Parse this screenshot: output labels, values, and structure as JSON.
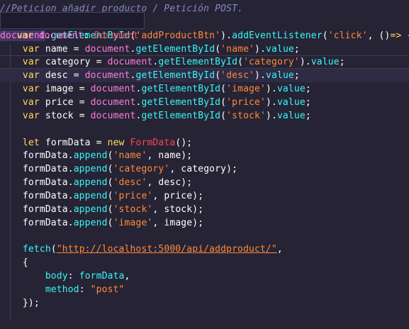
{
  "tooltip": {
    "keyword": "var",
    "identifier": "document",
    "separator": ": ",
    "type": "Document"
  },
  "code_lines": [
    [
      {
        "t": "//Peticion añadir producto / Petición POST.",
        "c": "cmt"
      }
    ],
    [
      {
        "t": "",
        "c": "plain"
      }
    ],
    [
      {
        "t": "document",
        "c": "var",
        "sel": true
      },
      {
        "t": ".",
        "c": "plain"
      },
      {
        "t": "getElementById",
        "c": "fn"
      },
      {
        "t": "(",
        "c": "plain"
      },
      {
        "t": "'addProductBtn'",
        "c": "str"
      },
      {
        "t": ").",
        "c": "plain"
      },
      {
        "t": "addEventListener",
        "c": "fn"
      },
      {
        "t": "(",
        "c": "plain"
      },
      {
        "t": "'click'",
        "c": "str"
      },
      {
        "t": ", ",
        "c": "plain"
      },
      {
        "t": "()",
        "c": "plain"
      },
      {
        "t": "=>",
        "c": "kw"
      },
      {
        "t": " {",
        "c": "plain"
      }
    ],
    [
      {
        "t": "    ",
        "c": "plain"
      },
      {
        "t": "var",
        "c": "kw"
      },
      {
        "t": " name = ",
        "c": "plain"
      },
      {
        "t": "document",
        "c": "var"
      },
      {
        "t": ".",
        "c": "plain"
      },
      {
        "t": "getElementById",
        "c": "fn"
      },
      {
        "t": "(",
        "c": "plain"
      },
      {
        "t": "'name'",
        "c": "str"
      },
      {
        "t": ").",
        "c": "plain"
      },
      {
        "t": "value",
        "c": "fn"
      },
      {
        "t": ";",
        "c": "plain"
      }
    ],
    [
      {
        "t": "    ",
        "c": "plain"
      },
      {
        "t": "var",
        "c": "kw"
      },
      {
        "t": " category = ",
        "c": "plain"
      },
      {
        "t": "document",
        "c": "var"
      },
      {
        "t": ".",
        "c": "plain"
      },
      {
        "t": "getElementById",
        "c": "fn"
      },
      {
        "t": "(",
        "c": "plain"
      },
      {
        "t": "'category'",
        "c": "str"
      },
      {
        "t": ").",
        "c": "plain"
      },
      {
        "t": "value",
        "c": "fn"
      },
      {
        "t": ";",
        "c": "plain"
      }
    ],
    [
      {
        "t": "    ",
        "c": "plain"
      },
      {
        "t": "var",
        "c": "kw"
      },
      {
        "t": " desc = ",
        "c": "plain"
      },
      {
        "t": "document",
        "c": "var"
      },
      {
        "t": ".",
        "c": "plain"
      },
      {
        "t": "getElementById",
        "c": "fn"
      },
      {
        "t": "(",
        "c": "plain"
      },
      {
        "t": "'desc'",
        "c": "str"
      },
      {
        "t": ").",
        "c": "plain"
      },
      {
        "t": "value",
        "c": "fn"
      },
      {
        "t": ";",
        "c": "plain"
      }
    ],
    [
      {
        "t": "    ",
        "c": "plain"
      },
      {
        "t": "var",
        "c": "kw"
      },
      {
        "t": " image = ",
        "c": "plain"
      },
      {
        "t": "document",
        "c": "var"
      },
      {
        "t": ".",
        "c": "plain"
      },
      {
        "t": "getElementById",
        "c": "fn"
      },
      {
        "t": "(",
        "c": "plain"
      },
      {
        "t": "'image'",
        "c": "str"
      },
      {
        "t": ").",
        "c": "plain"
      },
      {
        "t": "value",
        "c": "fn"
      },
      {
        "t": ";",
        "c": "plain"
      }
    ],
    [
      {
        "t": "    ",
        "c": "plain"
      },
      {
        "t": "var",
        "c": "kw"
      },
      {
        "t": " price = ",
        "c": "plain"
      },
      {
        "t": "document",
        "c": "var"
      },
      {
        "t": ".",
        "c": "plain"
      },
      {
        "t": "getElementById",
        "c": "fn"
      },
      {
        "t": "(",
        "c": "plain"
      },
      {
        "t": "'price'",
        "c": "str"
      },
      {
        "t": ").",
        "c": "plain"
      },
      {
        "t": "value",
        "c": "fn"
      },
      {
        "t": ";",
        "c": "plain"
      }
    ],
    [
      {
        "t": "    ",
        "c": "plain"
      },
      {
        "t": "var",
        "c": "kw"
      },
      {
        "t": " stock = ",
        "c": "plain"
      },
      {
        "t": "document",
        "c": "var"
      },
      {
        "t": ".",
        "c": "plain"
      },
      {
        "t": "getElementById",
        "c": "fn"
      },
      {
        "t": "(",
        "c": "plain"
      },
      {
        "t": "'stock'",
        "c": "str"
      },
      {
        "t": ").",
        "c": "plain"
      },
      {
        "t": "value",
        "c": "fn"
      },
      {
        "t": ";",
        "c": "plain"
      }
    ],
    [
      {
        "t": "",
        "c": "plain"
      }
    ],
    [
      {
        "t": "    ",
        "c": "plain"
      },
      {
        "t": "let",
        "c": "kw"
      },
      {
        "t": " formData = ",
        "c": "plain"
      },
      {
        "t": "new",
        "c": "kw"
      },
      {
        "t": " ",
        "c": "plain"
      },
      {
        "t": "FormData",
        "c": "class"
      },
      {
        "t": "();",
        "c": "plain"
      }
    ],
    [
      {
        "t": "    formData.",
        "c": "plain"
      },
      {
        "t": "append",
        "c": "fn"
      },
      {
        "t": "(",
        "c": "plain"
      },
      {
        "t": "'name'",
        "c": "str"
      },
      {
        "t": ", name);",
        "c": "plain"
      }
    ],
    [
      {
        "t": "    formData.",
        "c": "plain"
      },
      {
        "t": "append",
        "c": "fn"
      },
      {
        "t": "(",
        "c": "plain"
      },
      {
        "t": "'category'",
        "c": "str"
      },
      {
        "t": ", category);",
        "c": "plain"
      }
    ],
    [
      {
        "t": "    formData.",
        "c": "plain"
      },
      {
        "t": "append",
        "c": "fn"
      },
      {
        "t": "(",
        "c": "plain"
      },
      {
        "t": "'desc'",
        "c": "str"
      },
      {
        "t": ", desc);",
        "c": "plain"
      }
    ],
    [
      {
        "t": "    formData.",
        "c": "plain"
      },
      {
        "t": "append",
        "c": "fn"
      },
      {
        "t": "(",
        "c": "plain"
      },
      {
        "t": "'price'",
        "c": "str"
      },
      {
        "t": ", price);",
        "c": "plain"
      }
    ],
    [
      {
        "t": "    formData.",
        "c": "plain"
      },
      {
        "t": "append",
        "c": "fn"
      },
      {
        "t": "(",
        "c": "plain"
      },
      {
        "t": "'stock'",
        "c": "str"
      },
      {
        "t": ", stock);",
        "c": "plain"
      }
    ],
    [
      {
        "t": "    formData.",
        "c": "plain"
      },
      {
        "t": "append",
        "c": "fn"
      },
      {
        "t": "(",
        "c": "plain"
      },
      {
        "t": "'image'",
        "c": "str"
      },
      {
        "t": ", image);",
        "c": "plain"
      }
    ],
    [
      {
        "t": "",
        "c": "plain"
      }
    ],
    [
      {
        "t": "    ",
        "c": "plain"
      },
      {
        "t": "fetch",
        "c": "fn"
      },
      {
        "t": "(",
        "c": "plain"
      },
      {
        "t": "\"http://localhost:5000/api/addproduct/\"",
        "c": "url"
      },
      {
        "t": ",",
        "c": "plain"
      }
    ],
    [
      {
        "t": "    {",
        "c": "plain"
      }
    ],
    [
      {
        "t": "        ",
        "c": "plain"
      },
      {
        "t": "body",
        "c": "fn"
      },
      {
        "t": ": ",
        "c": "plain"
      },
      {
        "t": "formData",
        "c": "fn"
      },
      {
        "t": ",",
        "c": "plain"
      }
    ],
    [
      {
        "t": "        ",
        "c": "plain"
      },
      {
        "t": "method",
        "c": "fn"
      },
      {
        "t": ": ",
        "c": "plain"
      },
      {
        "t": "\"post\"",
        "c": "str"
      }
    ],
    [
      {
        "t": "    });",
        "c": "plain"
      }
    ]
  ]
}
